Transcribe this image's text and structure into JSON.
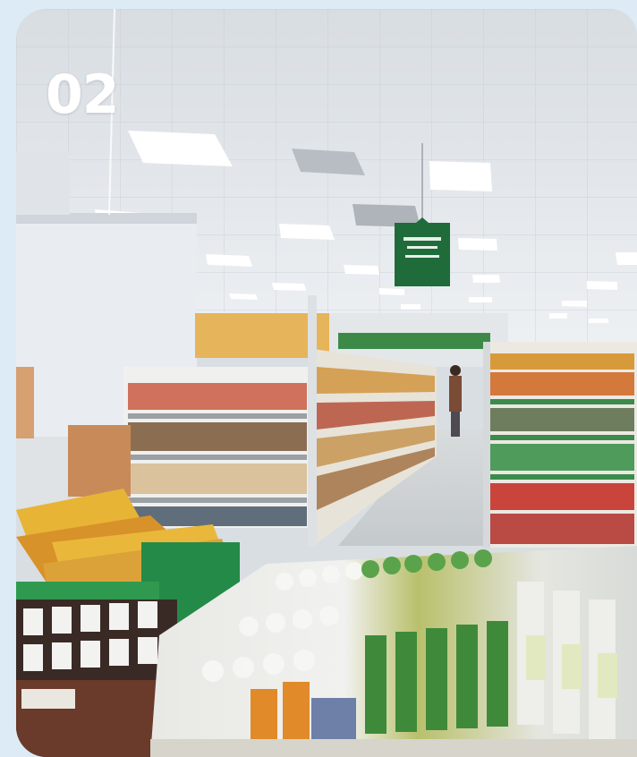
{
  "step_number": "02",
  "colors": {
    "page_background": "#dcebf5",
    "ceiling": "#e4e8ec",
    "sign_green": "#1f6b3a",
    "floor": "#cfd4d6"
  },
  "icons": [
    "hanging-aisle-sign"
  ]
}
